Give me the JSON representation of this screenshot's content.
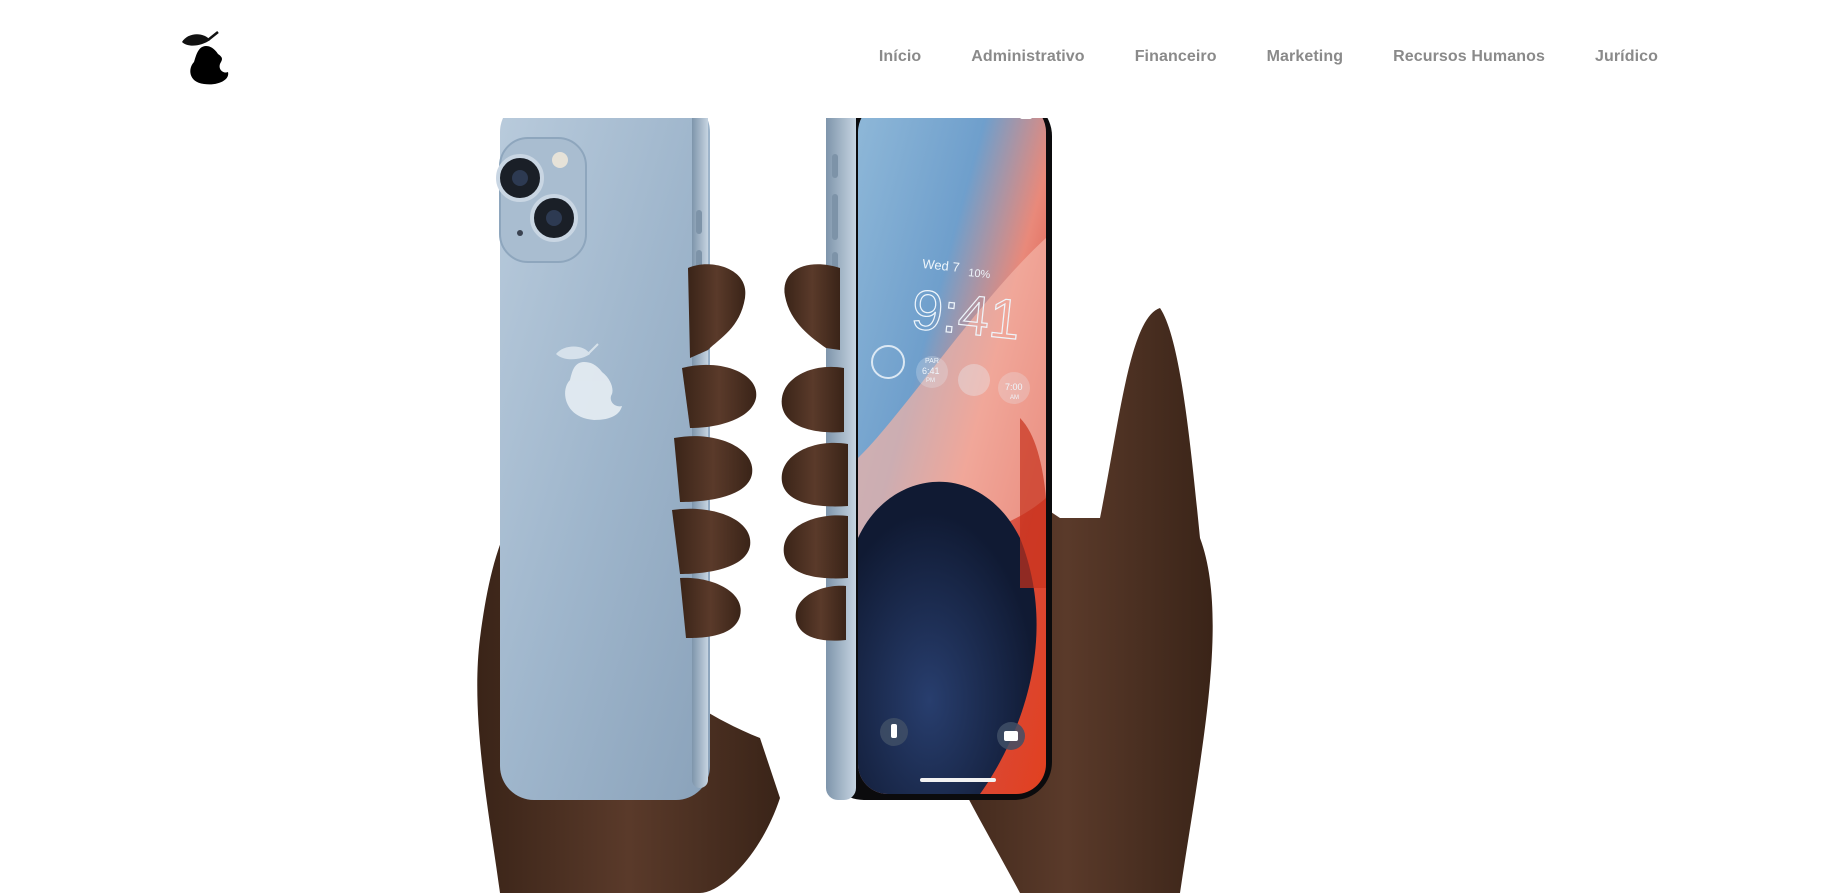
{
  "header": {
    "logo_icon": "pear-bite-logo-icon",
    "nav": [
      {
        "label": "Início"
      },
      {
        "label": "Administrativo"
      },
      {
        "label": "Financeiro"
      },
      {
        "label": "Marketing"
      },
      {
        "label": "Recursos Humanos"
      },
      {
        "label": "Jurídico"
      }
    ]
  },
  "hero": {
    "image": "hands-holding-phones-photo",
    "lockscreen": {
      "date": "Wed 7",
      "weather": "10%",
      "time": "9:41",
      "widget_par": "PAR",
      "widget_par_time": "6:41",
      "widget_par_ampm": "PM",
      "widget_alarm": "7:00",
      "widget_alarm_ampm": "AM"
    }
  },
  "colors": {
    "nav_text": "#8a8a8a",
    "phone_blue": "#9fb6cc",
    "skin": "#4a2f22",
    "background": "#ffffff"
  }
}
